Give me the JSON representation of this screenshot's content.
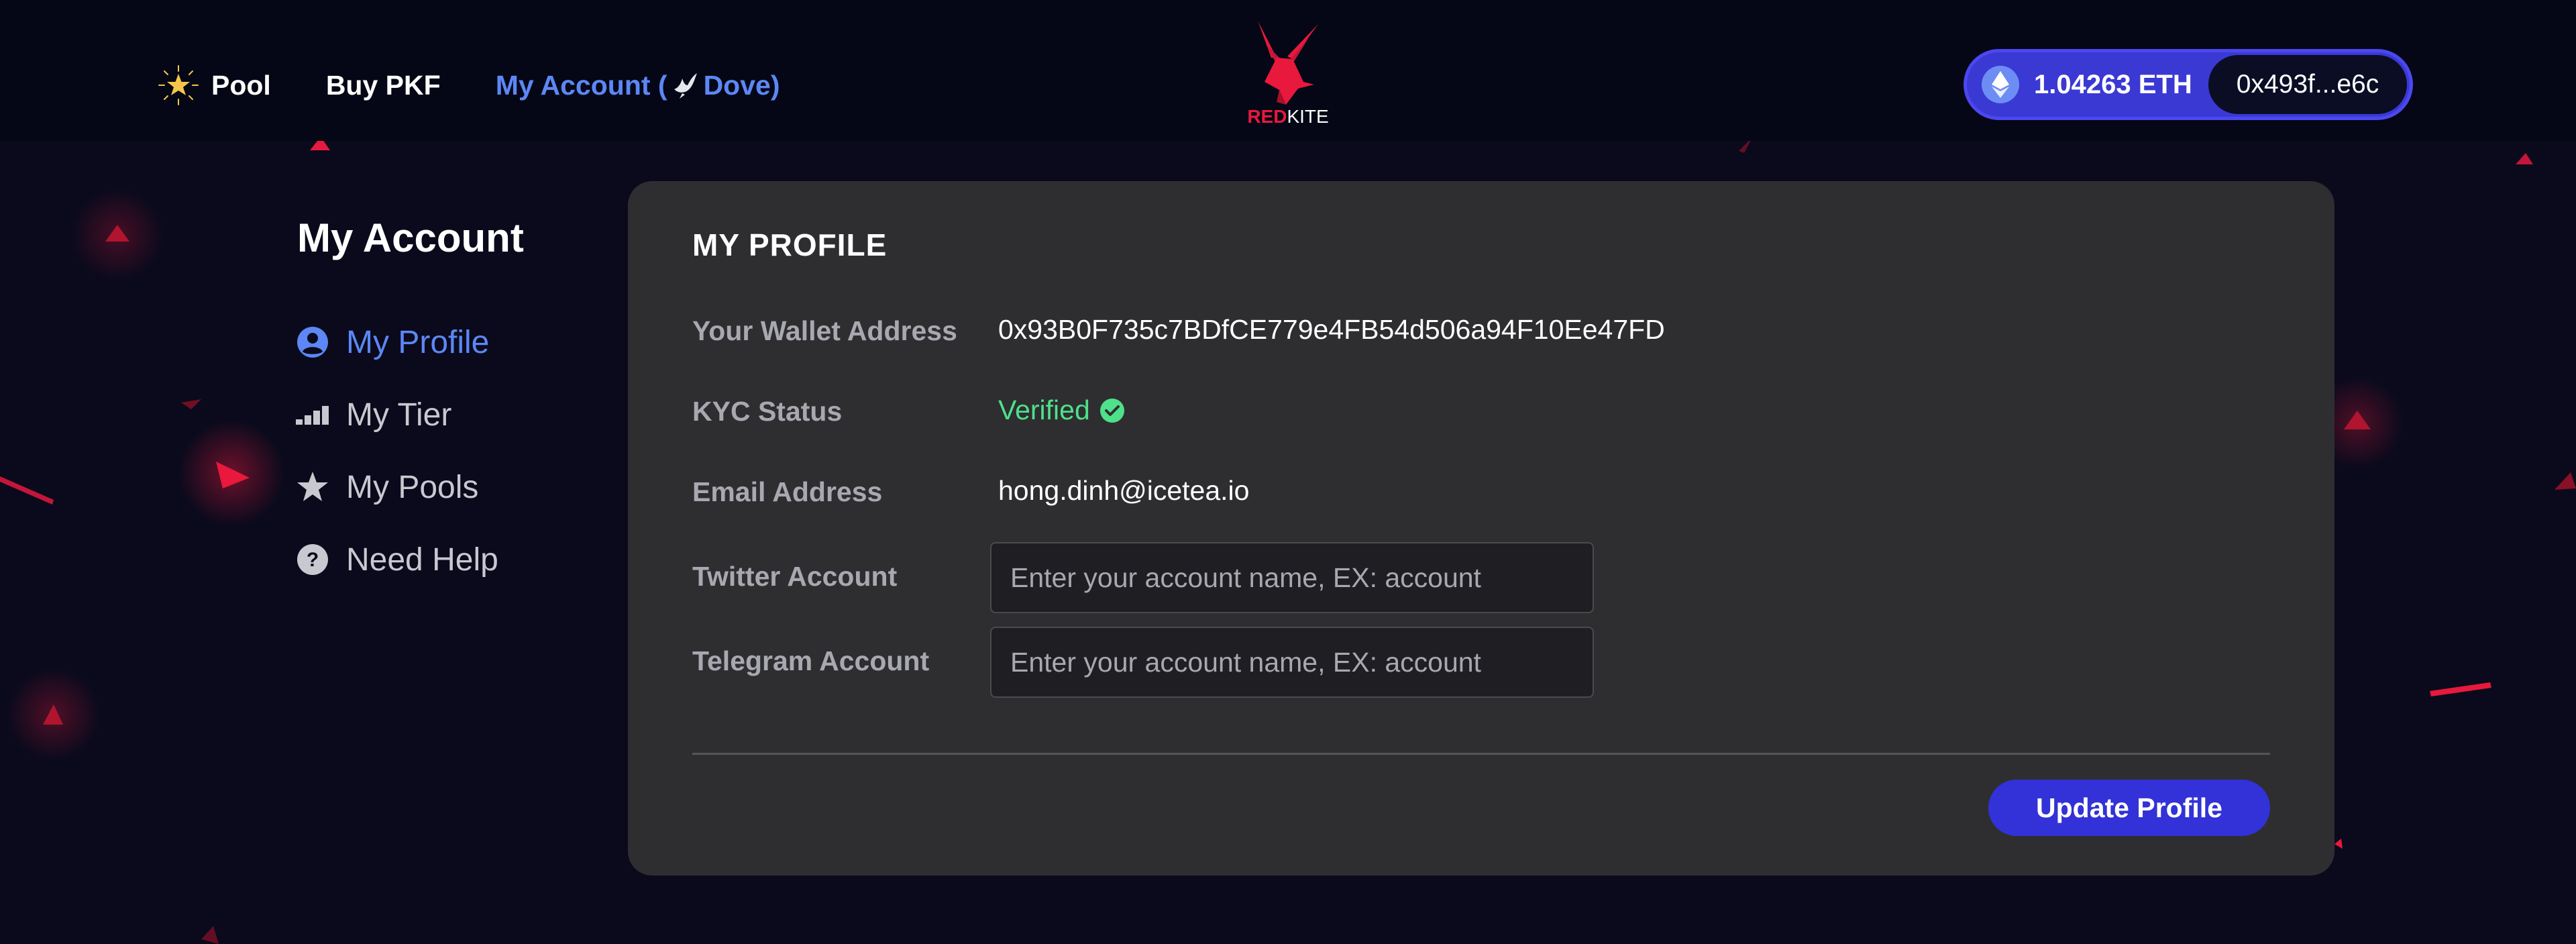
{
  "header": {
    "nav": {
      "pool_label": "Pool",
      "buy_label": "Buy PKF",
      "account_label_prefix": "My Account (",
      "account_tier_name": "Dove)"
    },
    "logo": {
      "word_red": "RED",
      "word_white": "KITE"
    },
    "wallet": {
      "balance": "1.04263 ETH",
      "address_short": "0x493f...e6c"
    }
  },
  "sidebar": {
    "title": "My Account",
    "items": [
      {
        "label": "My Profile",
        "icon": "user-circle-icon"
      },
      {
        "label": "My Tier",
        "icon": "signal-bars-icon"
      },
      {
        "label": "My Pools",
        "icon": "star-icon"
      },
      {
        "label": "Need Help",
        "icon": "question-circle-icon"
      }
    ]
  },
  "profile": {
    "title": "MY PROFILE",
    "wallet_label": "Your Wallet Address",
    "wallet_value": "0x93B0F735c7BDfCE779e4FB54d506a94F10Ee47FD",
    "kyc_label": "KYC Status",
    "kyc_value": "Verified",
    "email_label": "Email Address",
    "email_value": "hong.dinh@icetea.io",
    "twitter_label": "Twitter Account",
    "twitter_placeholder": "Enter your account name, EX: account",
    "telegram_label": "Telegram Account",
    "telegram_placeholder": "Enter your account name, EX: account",
    "update_button": "Update Profile"
  },
  "colors": {
    "background": "#0a0a1c",
    "accent_blue": "#5c87f5",
    "button_blue": "#3232d8",
    "brand_red": "#e8193c",
    "verified_green": "#4ee08a",
    "card": "#2e2e31"
  }
}
